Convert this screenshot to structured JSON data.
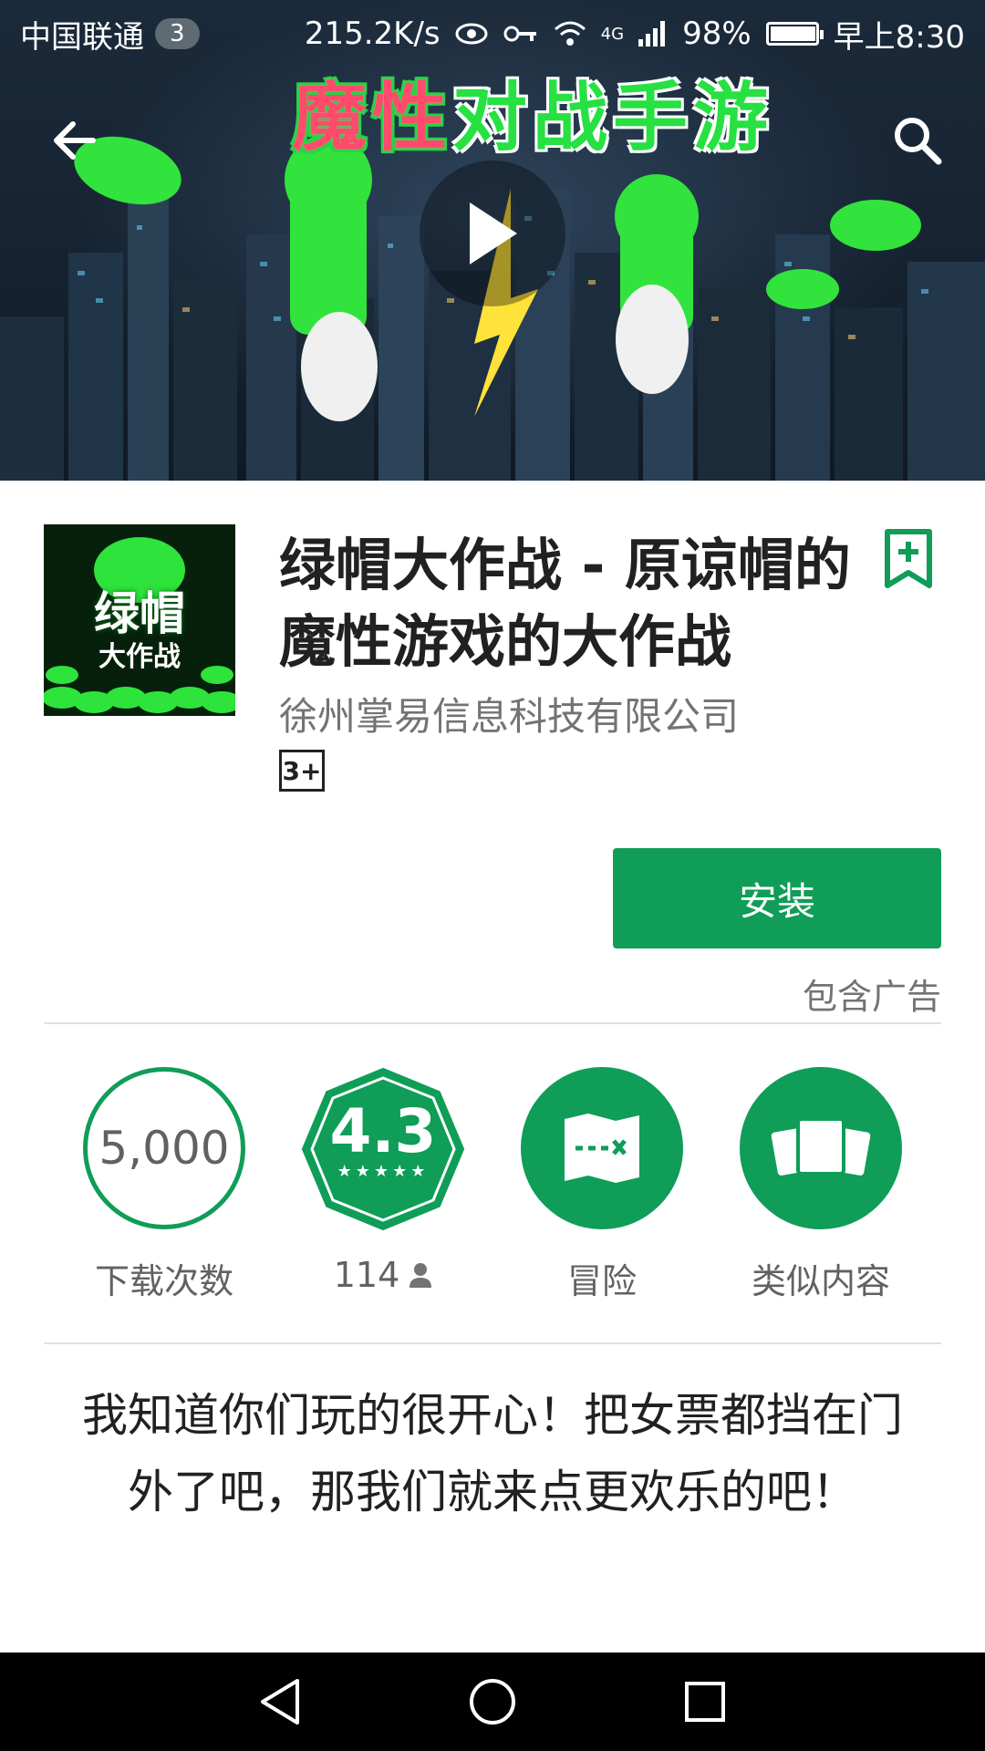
{
  "status_bar": {
    "carrier": "中国联通",
    "notification_count": "3",
    "network_speed": "215.2K/s",
    "network_type": "4G",
    "battery_percent": "98%",
    "battery_level": 0.98,
    "time": "早上8:30"
  },
  "banner": {
    "title_part1": "魔性",
    "title_part2": "对战手游"
  },
  "app": {
    "icon_text_main": "绿帽",
    "icon_text_sub": "大作战",
    "title": "绿帽大作战 - 原谅帽的魔性游戏的大作战",
    "developer": "徐州掌易信息科技有限公司",
    "content_rating": "3+",
    "install_label": "安装",
    "ads_note": "包含广告"
  },
  "stats": {
    "downloads_value": "5,000",
    "downloads_label": "下载次数",
    "rating_value": "4.3",
    "rating_stars": "★★★★★",
    "reviews_count": "114",
    "category_label": "冒险",
    "similar_label": "类似内容"
  },
  "description": "我知道你们玩的很开心！把女票都挡在门外了吧，那我们就来点更欢乐的吧！",
  "colors": {
    "accent": "#0f9d58",
    "text_primary": "#212121",
    "text_secondary": "#737373"
  },
  "icons": [
    "back-arrow-icon",
    "search-icon",
    "play-icon",
    "wishlist-add-icon",
    "person-icon",
    "map-icon",
    "cards-icon",
    "nav-back-icon",
    "nav-home-icon",
    "nav-recents-icon"
  ]
}
